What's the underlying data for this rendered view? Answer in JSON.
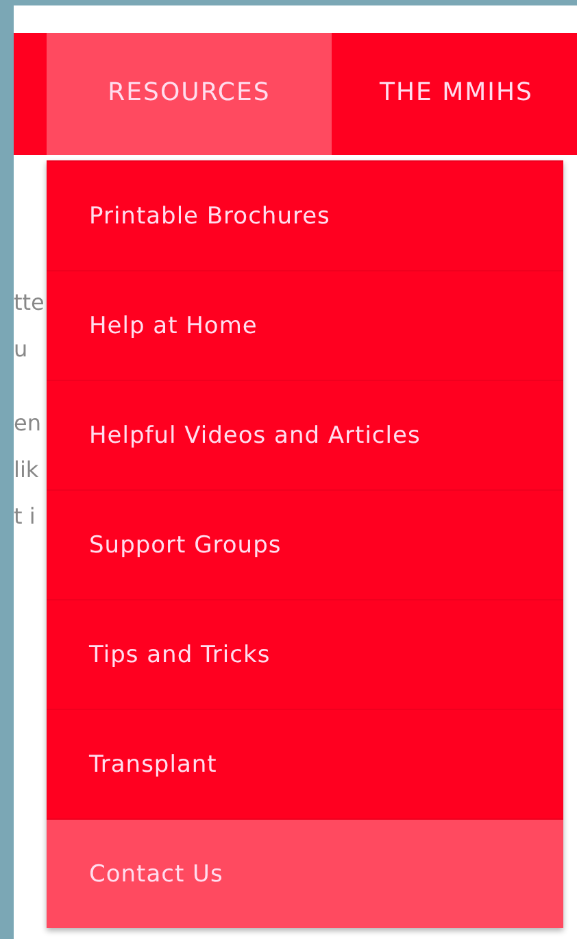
{
  "nav": {
    "items": [
      {
        "label": "RESOURCES",
        "selected": true
      },
      {
        "label": "THE MMIHS",
        "selected": false
      }
    ]
  },
  "dropdown": {
    "items": [
      {
        "label": "Printable Brochures",
        "selected": false
      },
      {
        "label": "Help at Home",
        "selected": false
      },
      {
        "label": "Helpful Videos and Articles",
        "selected": false
      },
      {
        "label": "Support Groups",
        "selected": false
      },
      {
        "label": "Tips and Tricks",
        "selected": false
      },
      {
        "label": "Transplant",
        "selected": false
      },
      {
        "label": "Contact Us",
        "selected": true
      }
    ]
  },
  "background_text": [
    {
      "lines": [
        "tte",
        "u"
      ]
    },
    {
      "lines": [
        "en",
        "lik",
        "t i"
      ]
    }
  ]
}
